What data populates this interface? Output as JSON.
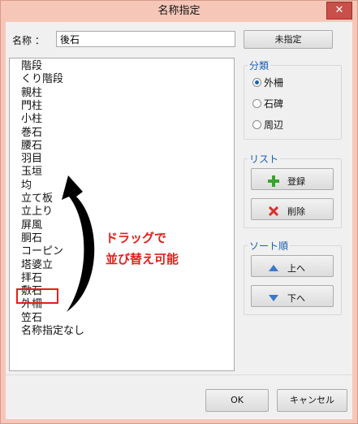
{
  "window": {
    "title": "名称指定",
    "close_glyph": "✕"
  },
  "name": {
    "label": "名称 ：",
    "value": "後石",
    "unset_button": "未指定"
  },
  "list_items": [
    "階段",
    "くり階段",
    "親柱",
    "門柱",
    "小柱",
    "巻石",
    "腰石",
    "羽目",
    "玉垣",
    "均",
    "立て板",
    "立上り",
    "屏風",
    "胴石",
    "コーピン",
    "塔婆立",
    "拝石",
    "敷石",
    "外柵",
    "笠石",
    "名称指定なし"
  ],
  "classification": {
    "title": "分類",
    "options": [
      {
        "label": "外柵",
        "selected": true
      },
      {
        "label": "石碑",
        "selected": false
      },
      {
        "label": "周辺",
        "selected": false
      }
    ]
  },
  "list_group": {
    "title": "リスト",
    "register": "登録",
    "delete": "削除"
  },
  "sort": {
    "title": "ソート順",
    "up": "上へ",
    "down": "下へ"
  },
  "annotation": {
    "line1": "ドラッグで",
    "line2": "並び替え可能"
  },
  "footer": {
    "ok": "OK",
    "cancel": "キャンセル"
  },
  "colors": {
    "annotation": "#e0201b",
    "group_title": "#1a5fb4",
    "add_icon": "#3aa233",
    "delete_icon": "#d9302b",
    "arrow_icon": "#3a78c9"
  }
}
